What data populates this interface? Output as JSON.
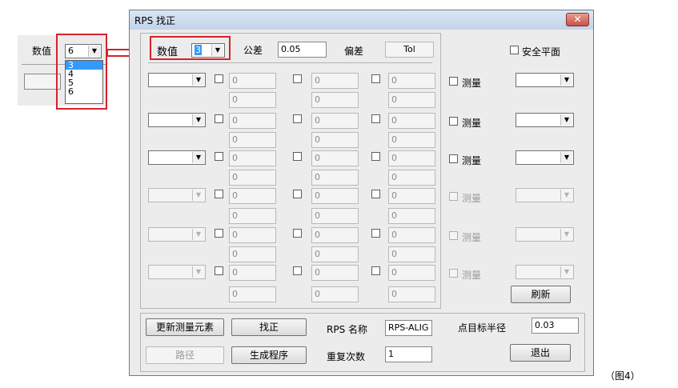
{
  "inset": {
    "label": "数值",
    "selected_value": "6",
    "options": [
      "3",
      "4",
      "5",
      "6"
    ]
  },
  "window": {
    "title": "RPS 找正",
    "close_glyph": "✕"
  },
  "header": {
    "count_label": "数值",
    "count_value": "3",
    "tolerance_label": "公差",
    "tolerance_value": "0.05",
    "deviation_label": "偏差",
    "tol_button": "Tol",
    "safe_plane_label": "安全平面"
  },
  "rows": [
    {
      "measure_label": "测量",
      "top": "0",
      "bottom": "0",
      "enabled": true
    },
    {
      "measure_label": "测量",
      "top": "0",
      "bottom": "0",
      "enabled": true
    },
    {
      "measure_label": "测量",
      "top": "0",
      "bottom": "0",
      "enabled": true
    },
    {
      "measure_label": "测量",
      "top": "0",
      "bottom": "0",
      "enabled": false
    },
    {
      "measure_label": "测量",
      "top": "0",
      "bottom": "0",
      "enabled": false
    },
    {
      "measure_label": "测量",
      "top": "0",
      "bottom": "0",
      "enabled": false
    }
  ],
  "buttons": {
    "refresh": "刷新",
    "update_elements": "更新测量元素",
    "align": "找正",
    "path": "路径",
    "generate": "生成程序",
    "exit": "退出"
  },
  "footer": {
    "rps_name_label": "RPS 名称",
    "rps_name_value": "RPS-ALIG",
    "repeat_label": "重复次数",
    "repeat_value": "1",
    "radius_label": "点目标半径",
    "radius_value": "0.03"
  },
  "figure_label": "（图4）",
  "colors": {
    "highlight_red": "#d6222c",
    "selection_blue": "#3399ff"
  }
}
